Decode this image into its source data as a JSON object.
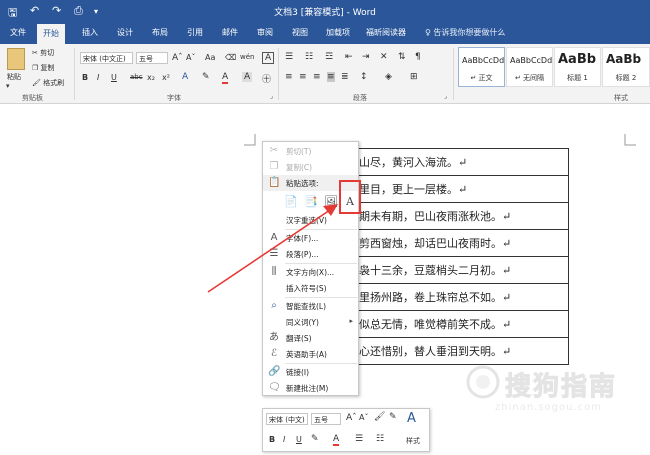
{
  "title_bar": {
    "title": "文档3 [兼容模式] - Word",
    "quick_access": [
      "save-icon",
      "undo-icon",
      "redo-icon",
      "print-preview-icon",
      "customize-icon"
    ]
  },
  "tabs": [
    {
      "label": "文件"
    },
    {
      "label": "开始"
    },
    {
      "label": "插入"
    },
    {
      "label": "设计"
    },
    {
      "label": "布局"
    },
    {
      "label": "引用"
    },
    {
      "label": "邮件"
    },
    {
      "label": "审阅"
    },
    {
      "label": "视图"
    },
    {
      "label": "加载项"
    },
    {
      "label": "福昕阅读器"
    }
  ],
  "active_tab": "开始",
  "tell_me": "告诉我你想要做什么",
  "ribbon": {
    "clipboard": {
      "paste": "粘贴",
      "cut": "剪切",
      "copy": "复制",
      "format_painter": "格式刷",
      "label": "剪贴板"
    },
    "font": {
      "font_name": "宋体 (中文正)",
      "font_size": "五号",
      "grow": "Aˆ",
      "shrink": "Aˇ",
      "change_case": "Aa",
      "clear": "A",
      "phonetic": "wén",
      "char_border": "A",
      "bold": "B",
      "italic": "I",
      "underline": "U",
      "strikethrough": "abc",
      "subscript": "x₂",
      "superscript": "x²",
      "label": "字体"
    },
    "paragraph": {
      "label": "段落"
    },
    "styles": {
      "items": [
        {
          "preview": "AaBbCcDd",
          "name": "↵ 正文"
        },
        {
          "preview": "AaBbCcDd",
          "name": "↵ 无间隔"
        },
        {
          "preview": "AaBb",
          "name": "标题 1"
        },
        {
          "preview": "AaBb",
          "name": "标题 2"
        }
      ],
      "label": "样式"
    }
  },
  "document": {
    "rows": [
      "山尽，黄河入海流。↵",
      "里目，更上一层楼。↵",
      "期未有期，巴山夜雨涨秋池。↵",
      "剪西窗烛，却话巴山夜雨时。↵",
      "袅十三余，豆蔻梢头二月初。↵",
      "里扬州路，卷上珠帘总不如。↵",
      "似总无情，唯觉樽前笑不成。↵",
      "心还惜别，替人垂泪到天明。↵"
    ]
  },
  "context_menu": {
    "cut": "剪切(T)",
    "copy": "复制(C)",
    "paste_options": "粘贴选项:",
    "hanzi_reselect": "汉字重选(V)",
    "font": "字体(F)...",
    "paragraph": "段落(P)...",
    "text_direction": "文字方向(X)...",
    "insert_symbol": "插入符号(S)",
    "smart_lookup": "智能查找(L)",
    "synonyms": "同义词(Y)",
    "translate": "翻译(S)",
    "english_assistant": "英语助手(A)",
    "link": "链接(I)",
    "new_comment": "新建批注(M)"
  },
  "mini_toolbar": {
    "font_name": "宋体 (中文)",
    "font_size": "五号",
    "grow": "Aˆ",
    "shrink": "Aˇ",
    "bold": "B",
    "italic": "I",
    "underline": "U",
    "styles": "样式"
  },
  "watermark": {
    "text": "搜狗指南",
    "url": "zhinan.sogou.com"
  },
  "colors": {
    "brand": "#2b579a",
    "highlight_box": "#e53935",
    "arrow": "#e53935"
  }
}
